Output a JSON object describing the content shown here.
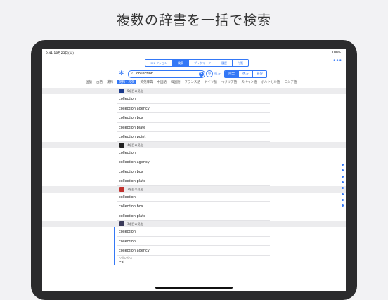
{
  "headline": "複数の辞書を一括で検索",
  "status": {
    "time": "9:41 10月23日(火)",
    "battery": "100%"
  },
  "tabs": [
    {
      "label": "コレクション",
      "active": false
    },
    {
      "label": "検索",
      "active": true
    },
    {
      "label": "ブックマーク",
      "active": false
    },
    {
      "label": "履歴",
      "active": false
    },
    {
      "label": "付箋",
      "active": false
    }
  ],
  "search": {
    "value": "collection",
    "placeholder": ""
  },
  "mode_label": "前方",
  "modes": [
    {
      "label": "完全",
      "active": true
    },
    {
      "label": "後方",
      "active": false
    },
    {
      "label": "部分",
      "active": false
    }
  ],
  "languages": [
    {
      "label": "国語",
      "active": false
    },
    {
      "label": "古語",
      "active": false
    },
    {
      "label": "漢和",
      "active": false
    },
    {
      "label": "英和・和英",
      "active": true
    },
    {
      "label": "英英辞典",
      "active": false
    },
    {
      "label": "中国語",
      "active": false
    },
    {
      "label": "韓国語",
      "active": false
    },
    {
      "label": "フランス語",
      "active": false
    },
    {
      "label": "ドイツ語",
      "active": false
    },
    {
      "label": "イタリア語",
      "active": false
    },
    {
      "label": "スペイン語",
      "active": false
    },
    {
      "label": "ポルトガル語",
      "active": false
    },
    {
      "label": "ロシア語",
      "active": false
    }
  ],
  "sections": [
    {
      "label": "5項目の見出",
      "color": "#1b3a8c",
      "items": [
        "collection",
        "collection agency",
        "collection box",
        "collection plate",
        "collection point"
      ]
    },
    {
      "label": "4項目の見出",
      "color": "#222222",
      "items": [
        "collection",
        "collection agency",
        "collection box",
        "collection plate"
      ]
    },
    {
      "label": "3項目の見出",
      "color": "#c0322e",
      "items": [
        "collection",
        "collection box",
        "collection plate"
      ]
    },
    {
      "label": "3項目の見出",
      "color": "#3a3a5a",
      "items": [
        "collection",
        "collection",
        "collection agency"
      ]
    }
  ],
  "trailing": {
    "word": "collection",
    "sub": "~al"
  },
  "colors": {
    "accent": "#3478f6"
  }
}
